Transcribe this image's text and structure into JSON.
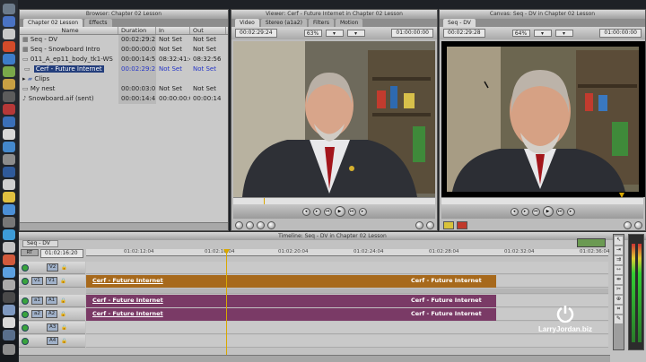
{
  "browser": {
    "title": "Browser: Chapter 02 Lesson",
    "tabs": [
      "Chapter 02 Lesson",
      "Effects"
    ],
    "columns": [
      "Name",
      "Duration",
      "In",
      "Out"
    ],
    "rows": [
      {
        "name": "Seq - DV",
        "duration": "00:02:29:2",
        "in": "Not Set",
        "out": "Not Set"
      },
      {
        "name": "Seq - Snowboard Intro",
        "duration": "00:00:00:0",
        "in": "Not Set",
        "out": "Not Set"
      },
      {
        "name": "011_A_ep11_body_tk1-WS",
        "duration": "00:00:14:5",
        "in": "08:32:41:4",
        "out": "08:32:56"
      },
      {
        "name": "Cerf - Future Internet",
        "duration": "00:02:29:2",
        "in": "Not Set",
        "out": "Not Set"
      },
      {
        "name": "Clips",
        "duration": "",
        "in": "",
        "out": ""
      },
      {
        "name": "My nest",
        "duration": "00:00:03:0",
        "in": "Not Set",
        "out": "Not Set"
      },
      {
        "name": "Snowboard.aif (sent)",
        "duration": "00:00:14:4",
        "in": "00:00:00:0",
        "out": "00:00:14"
      }
    ]
  },
  "viewer": {
    "title": "Viewer: Cerf - Future Internet in Chapter 02 Lesson",
    "tabs": [
      "Video",
      "Stereo (a1a2)",
      "Filters",
      "Motion"
    ],
    "timecode": "00:02:29:24",
    "zoom": "63%",
    "timecode_right": "01:00:00:00"
  },
  "canvas": {
    "title": "Canvas: Seq - DV in Chapter 02 Lesson",
    "tab": "Seq - DV",
    "timecode": "00:02:29:28",
    "zoom": "64%",
    "timecode_right": "01:00:00:00"
  },
  "timeline": {
    "title": "Timeline: Seq - DV in Chapter 02 Lesson",
    "tab": "Seq - DV",
    "current_tc": "01:02:16:20",
    "rt_label": "RT",
    "ruler": [
      "01:02:12:04",
      "01:02:16:04",
      "01:02:20:04",
      "01:02:24:04",
      "01:02:28:04",
      "01:02:32:04",
      "01:02:36:04"
    ],
    "tracks": [
      {
        "src": "",
        "dst": "V2"
      },
      {
        "src": "v1",
        "dst": "V1"
      },
      {
        "src": "a1",
        "dst": "A1"
      },
      {
        "src": "a2",
        "dst": "A2"
      },
      {
        "src": "",
        "dst": "A3"
      },
      {
        "src": "",
        "dst": "A4"
      }
    ],
    "clip_label": "Cerf - Future Internet"
  },
  "watermark": "LarryJordan.biz",
  "colors": {
    "video_clip": "#a7691c",
    "audio_clip": "#7a3a66",
    "selection": "#233e7c"
  }
}
